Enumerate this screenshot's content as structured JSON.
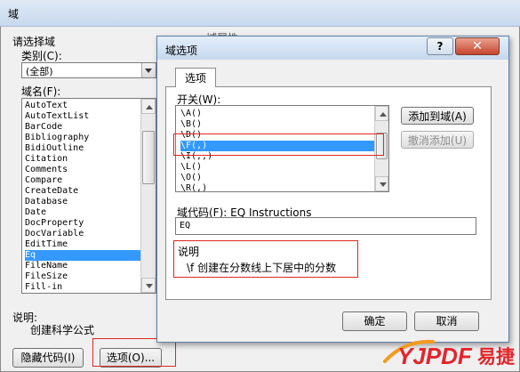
{
  "back_dialog": {
    "title": "域",
    "choose_field_label": "请选择域",
    "category_label": "类别(C):",
    "category_value": "(全部)",
    "field_names_label": "域名(F):",
    "field_names": [
      "AutoText",
      "AutoTextList",
      "BarCode",
      "Bibliography",
      "BidiOutline",
      "Citation",
      "Comments",
      "Compare",
      "CreateDate",
      "Database",
      "Date",
      "DocProperty",
      "DocVariable",
      "EditTime",
      "Eq",
      "FileName",
      "FileSize",
      "Fill-in"
    ],
    "selected_field": "Eq",
    "description_label": "说明:",
    "description_text": "创建科学公式",
    "hide_codes_button": "隐藏代码(I)",
    "options_button": "选项(O)...",
    "partial_heading": "域属性"
  },
  "options_dialog": {
    "title": "域选项",
    "help_label": "?",
    "close_label": "✕",
    "tab_label": "选项",
    "switches_label": "开关(W):",
    "switches": [
      "\\A()",
      "\\B()",
      "\\D()",
      "\\F(,)",
      "\\I(,,)",
      "\\L()",
      "\\O()",
      "\\R(,)"
    ],
    "selected_switch": "\\F(,)",
    "add_to_field_button": "添加到域(A)",
    "undo_add_button": "撤消添加(U)",
    "field_codes_label": "域代码(F): EQ Instructions",
    "field_codes_value": "EQ",
    "description_label": "说明",
    "description_text": "\\f 创建在分数线上下居中的分数",
    "ok_button": "确定",
    "cancel_button": "取消"
  },
  "watermark": {
    "brand": "YJPDF易捷"
  },
  "colors": {
    "selection": "#3399ff",
    "highlight_box": "#e0261f",
    "watermark_red": "#e4242b",
    "watermark_orange": "#f39a1f"
  }
}
